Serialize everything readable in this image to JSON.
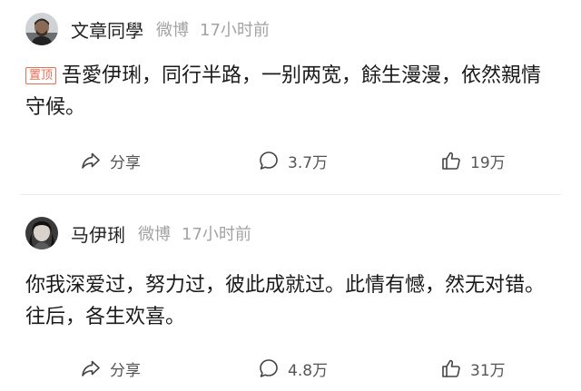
{
  "posts": [
    {
      "user": {
        "name": "文章同學"
      },
      "source": "微博",
      "time": "17小时前",
      "pinned_label": "置顶",
      "text": "吾愛伊琍，同行半路，一别两宽，餘生漫漫，依然親情守候。",
      "actions": {
        "share_label": "分享",
        "comment_count": "3.7万",
        "like_count": "19万"
      }
    },
    {
      "user": {
        "name": "马伊琍"
      },
      "source": "微博",
      "time": "17小时前",
      "text": "你我深爱过，努力过，彼此成就过。此情有憾，然无对错。往后，各生欢喜。",
      "actions": {
        "share_label": "分享",
        "comment_count": "4.8万",
        "like_count": "31万"
      }
    }
  ],
  "icons": {
    "share": "share-icon",
    "comment": "comment-icon",
    "like": "thumbs-up-icon"
  },
  "colors": {
    "pin_badge": "#e86d55",
    "meta_text": "#a3a3a3",
    "divider": "#ececec"
  }
}
